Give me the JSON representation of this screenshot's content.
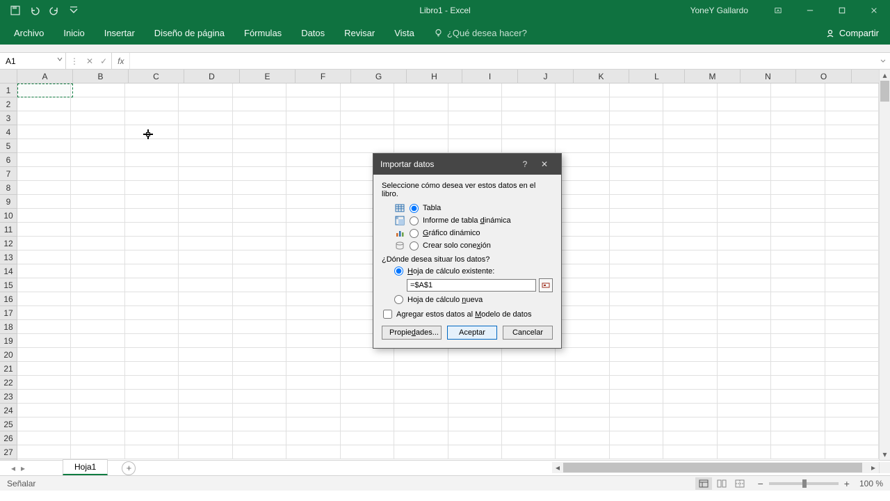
{
  "titlebar": {
    "title": "Libro1  -  Excel",
    "username": "YoneY Gallardo"
  },
  "ribbon": {
    "tabs": [
      "Archivo",
      "Inicio",
      "Insertar",
      "Diseño de página",
      "Fórmulas",
      "Datos",
      "Revisar",
      "Vista"
    ],
    "tell_me": "¿Qué desea hacer?",
    "share": "Compartir"
  },
  "formula_bar": {
    "name_box": "A1",
    "formula": ""
  },
  "grid": {
    "columns": [
      "A",
      "B",
      "C",
      "D",
      "E",
      "F",
      "G",
      "H",
      "I",
      "J",
      "K",
      "L",
      "M",
      "N",
      "O"
    ],
    "rows": 27
  },
  "sheet_tabs": {
    "active": "Hoja1"
  },
  "status_bar": {
    "mode": "Señalar",
    "zoom": "100 %"
  },
  "dialog": {
    "title": "Importar datos",
    "prompt1": "Seleccione cómo desea ver estos datos en el libro.",
    "view_options": {
      "table": "Tabla",
      "pivot_report": "Informe de tabla dinámica",
      "pivot_chart": "Gráfico dinámico",
      "connection_only": "Crear solo conexión"
    },
    "prompt2": "¿Dónde desea situar los datos?",
    "location": {
      "existing_label": "Hoja de cálculo existente:",
      "existing_ref": "=$A$1",
      "new_label": "Hoja de cálculo nueva"
    },
    "add_to_model": "Agregar estos datos al Modelo de datos",
    "buttons": {
      "properties": "Propiedades...",
      "ok": "Aceptar",
      "cancel": "Cancelar"
    }
  }
}
